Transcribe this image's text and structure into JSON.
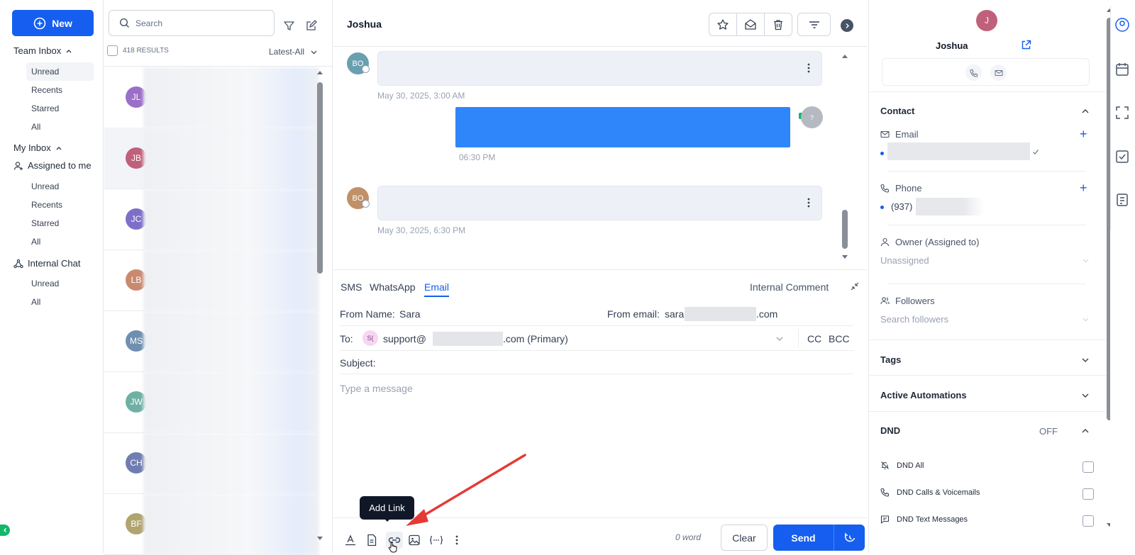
{
  "left_nav": {
    "new_button": "New",
    "team_inbox": "Team Inbox",
    "team_items": [
      "Unread",
      "Recents",
      "Starred",
      "All"
    ],
    "my_inbox": "My Inbox",
    "assigned_to_me": "Assigned to me",
    "assigned_items": [
      "Unread",
      "Recents",
      "Starred",
      "All"
    ],
    "internal_chat": "Internal Chat",
    "internal_items": [
      "Unread",
      "All"
    ]
  },
  "conv_list": {
    "search_placeholder": "Search",
    "results": "418 RESULTS",
    "sort": "Latest-All",
    "rows": [
      {
        "initials": "JL",
        "color": "#9b6fc9"
      },
      {
        "initials": "JB",
        "color": "#c0607a"
      },
      {
        "initials": "JC",
        "color": "#7d6fc9"
      },
      {
        "initials": "LB",
        "color": "#c98a6f"
      },
      {
        "initials": "MS",
        "color": "#6f8fb0"
      },
      {
        "initials": "JW",
        "color": "#6fb0a4"
      },
      {
        "initials": "CH",
        "color": "#6f7db0"
      },
      {
        "initials": "BF",
        "color": "#b0a46f"
      }
    ]
  },
  "conversation": {
    "contact_name": "Joshua",
    "messages": [
      {
        "avatar": "BO",
        "timestamp": "May 30, 2025, 3:00 AM"
      },
      {
        "avatar": "?",
        "timestamp": "06:30 PM"
      },
      {
        "avatar": "BO",
        "timestamp": "May 30, 2025, 6:30 PM"
      }
    ]
  },
  "composer": {
    "tabs": [
      "SMS",
      "WhatsApp",
      "Email"
    ],
    "active_tab": "Email",
    "internal_comment": "Internal Comment",
    "from_name_label": "From Name:",
    "from_name_value": "Sara",
    "from_email_label": "From email:",
    "from_email_prefix": "sara",
    "from_email_suffix": ".com",
    "to_label": "To:",
    "to_chip": "S(",
    "to_prefix": "support@",
    "to_suffix": ".com (Primary)",
    "cc": "CC",
    "bcc": "BCC",
    "subject_label": "Subject:",
    "message_placeholder": "Type a message",
    "word_count": "0 word",
    "clear": "Clear",
    "send": "Send",
    "tooltip": "Add Link"
  },
  "contact_panel": {
    "avatar_initial": "J",
    "name": "Joshua",
    "contact_section": "Contact",
    "email_label": "Email",
    "phone_label": "Phone",
    "phone_prefix": "(937)",
    "owner_label": "Owner (Assigned to)",
    "owner_value": "Unassigned",
    "followers_label": "Followers",
    "followers_placeholder": "Search followers",
    "tags": "Tags",
    "active_automations": "Active Automations",
    "dnd": "DND",
    "dnd_state": "OFF",
    "dnd_all": "DND All",
    "dnd_calls": "DND Calls & Voicemails",
    "dnd_text": "DND Text Messages"
  },
  "colors": {
    "primary": "#155eef",
    "outgoing_bubble": "#2f86fb",
    "annotation_arrow": "#e53935"
  }
}
